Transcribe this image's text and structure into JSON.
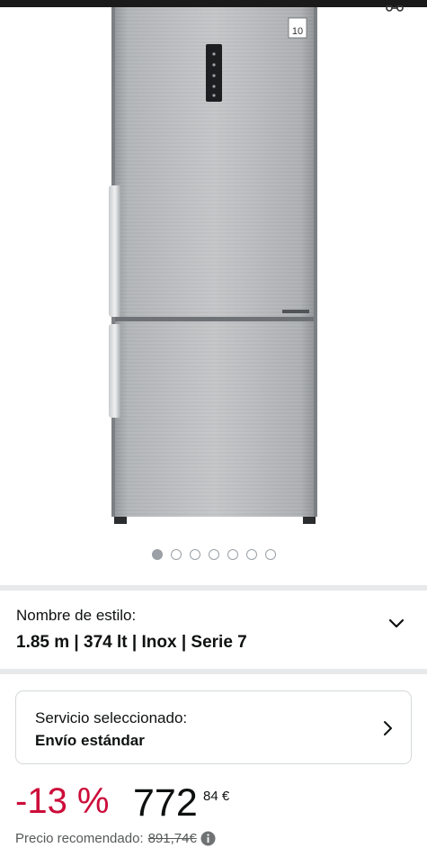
{
  "product": {
    "image_alt": "Frigorífico combi LG inox",
    "image_count": 7,
    "active_image_index": 0,
    "badge_text": "10"
  },
  "style": {
    "label": "Nombre de estilo:",
    "value": "1.85 m | 374 lt | Inox | Serie 7"
  },
  "service": {
    "label": "Servicio seleccionado:",
    "value": "Envío estándar"
  },
  "price": {
    "discount": "-13 %",
    "whole": "772",
    "fraction": "84 €",
    "rrp_label": "Precio recomendado:",
    "rrp_value": "891,74€"
  },
  "colors": {
    "discount": "#cc0c39",
    "text": "#0f1111",
    "muted": "#565959",
    "separator": "#e7e9ea"
  },
  "icons": {
    "share": "share-icon",
    "style_dropdown": "chevron-down-icon",
    "service_open": "chevron-right-icon",
    "info": "info-icon"
  }
}
